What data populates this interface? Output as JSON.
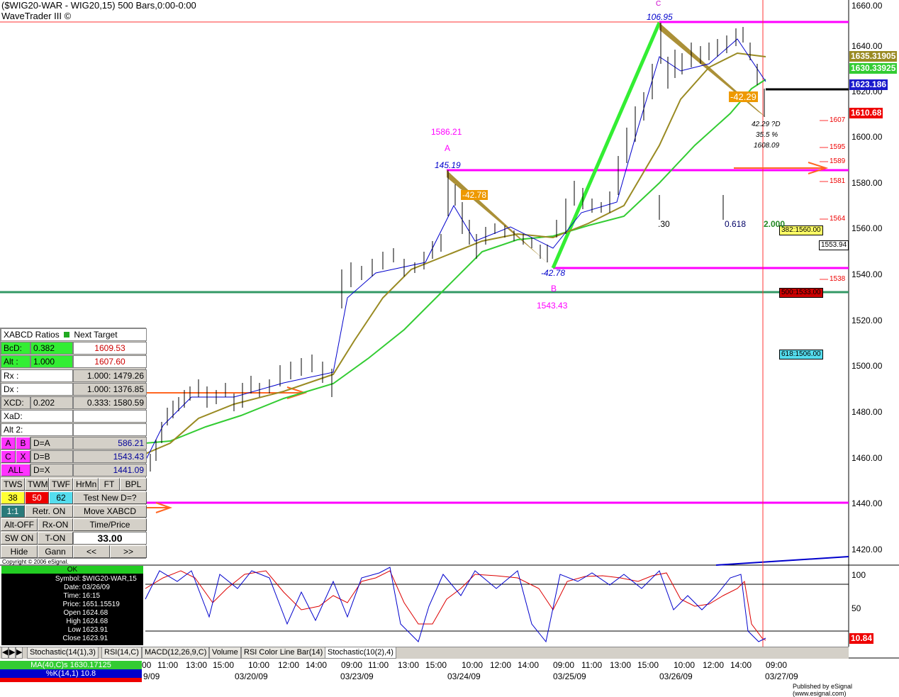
{
  "header": {
    "title": "($WIG20-WAR - WIG20,15) 500 Bars,0:00-0:00",
    "subtitle": "WaveTrader III ©"
  },
  "price_axis": {
    "labels": [
      "1660.00",
      "1640.00",
      "1620.00",
      "1600.00",
      "1580.00",
      "1560.00",
      "1540.00",
      "1520.00",
      "1500.00",
      "1480.00",
      "1460.00",
      "1440.00",
      "1420.00"
    ]
  },
  "price_tags": {
    "ma1": "1635.31905",
    "ma2": "1630.33925",
    "last": "1623.186",
    "close": "1610.68",
    "osc": "10.84",
    "small_1553": "1553.94",
    "fib_382": "382:1560.00",
    "fib_500": "500:1533.00",
    "fib_618": "618:1506.00"
  },
  "levels": {
    "l1607": "1607",
    "l1595": "1595",
    "l1589": "1589",
    "l1581": "1581",
    "l1564": "1564",
    "l1538": "1538"
  },
  "annotations": {
    "c_top": "C",
    "c_val": "106.95",
    "a_price": "1586.21",
    "a_letter": "A",
    "a_val": "145.19",
    "a_ratio": "-42.78",
    "b_val": "-42.78",
    "b_letter": "B",
    "b_price": "1543.43",
    "d_ratio": "-42.29",
    "d_info1": "42.29 ?D",
    "d_info2": "35.5 %",
    "d_info3": "1608.09",
    "r_30": ".30",
    "r_618": "0.618",
    "r_2000": "2.000"
  },
  "oscillator_axis": {
    "top": "100",
    "mid": "50"
  },
  "xabcd_panel": {
    "title": "XABCD Ratios",
    "next_target": "Next Target",
    "bcd_label": "BcD:",
    "bcd_val": "0.382",
    "bcd_target": "1609.53",
    "alt_label": "Alt :",
    "alt_val": "1.000",
    "alt_target": "1607.60",
    "rx_label": "Rx   :",
    "rx_val": "1.000: 1479.26",
    "dx_label": "Dx   :",
    "dx_val": "1.000: 1376.85",
    "xcd_label": "XCD:",
    "xcd_v1": "0.202",
    "xcd_v2": "0.333: 1580.59",
    "xad_label": "XaD:",
    "alt2_label": "Alt 2:",
    "btn_a": "A",
    "btn_b": "B",
    "da_label": "D=A",
    "da_val": "586.21",
    "btn_c": "C",
    "btn_x": "X",
    "db_label": "D=B",
    "db_val": "1543.43",
    "btn_all": "ALL",
    "dx2_label": "D=X",
    "dx2_val": "1441.09",
    "tws": "TWS",
    "twm": "TWM",
    "twf": "TWF",
    "hrmn": "HrMn",
    "ft": "FT",
    "bpl": "BPL",
    "n38": "38",
    "n50": "50",
    "n62": "62",
    "test_new": "Test New D=?",
    "one_one": "1:1",
    "retr_on": "Retr. ON",
    "move_xabcd": "Move XABCD",
    "alt_off": "Alt-OFF",
    "rx_on": "Rx-ON",
    "time_price": "Time/Price",
    "sw_on": "SW ON",
    "t_on": "T-ON",
    "value": "33.00",
    "hide": "Hide",
    "gann": "Gann",
    "prev": "<<",
    "next": ">>"
  },
  "copyright": "Copyright © 2006 eSignal.",
  "data_window": {
    "status": "OK",
    "rows": [
      {
        "k": "Symbol:",
        "v": "$WIG20-WAR,15"
      },
      {
        "k": "Date:",
        "v": "03/26/09"
      },
      {
        "k": "Time:",
        "v": "16:15"
      },
      {
        "k": "Price:",
        "v": "1651.15519"
      },
      {
        "k": "Open",
        "v": "1624.68"
      },
      {
        "k": "High",
        "v": "1624.68"
      },
      {
        "k": "Low",
        "v": "1623.91"
      },
      {
        "k": "Close",
        "v": "1623.91"
      }
    ]
  },
  "ma_legend": {
    "ma40": "MA(40,C)s 1630.17125",
    "k14": "%K(14,1) 10.8"
  },
  "tabs": [
    "Stochastic(14(1),3)",
    "RSI(14,C)",
    "MACD(12,26,9,C)",
    "Volume",
    "RSI Color Line Bar(14)",
    "Stochastic(10(2),4)"
  ],
  "time_axis": [
    "00",
    "11:00",
    "13:00",
    "15:00",
    "10:00",
    "12:00",
    "14:00",
    "09:00",
    "11:00",
    "13:00",
    "15:00",
    "10:00",
    "12:00",
    "14:00",
    "09:00",
    "11:00",
    "13:00",
    "15:00",
    "10:00",
    "12:00",
    "14:00",
    "09:00"
  ],
  "date_axis": [
    "9/09",
    "03/20/09",
    "03/23/09",
    "03/24/09",
    "03/25/09",
    "03/26/09",
    "03/27/09"
  ],
  "footer": "Published by eSignal (www.esignal.com)",
  "colors": {
    "magenta": "#ff00ff",
    "green_ma": "#33cc33",
    "olive_ma": "#998a22",
    "blue": "#0000cc",
    "pattern": "#9c7d14",
    "bright_green": "#33ee33",
    "red": "#ff0000",
    "orange": "#ff6622"
  }
}
